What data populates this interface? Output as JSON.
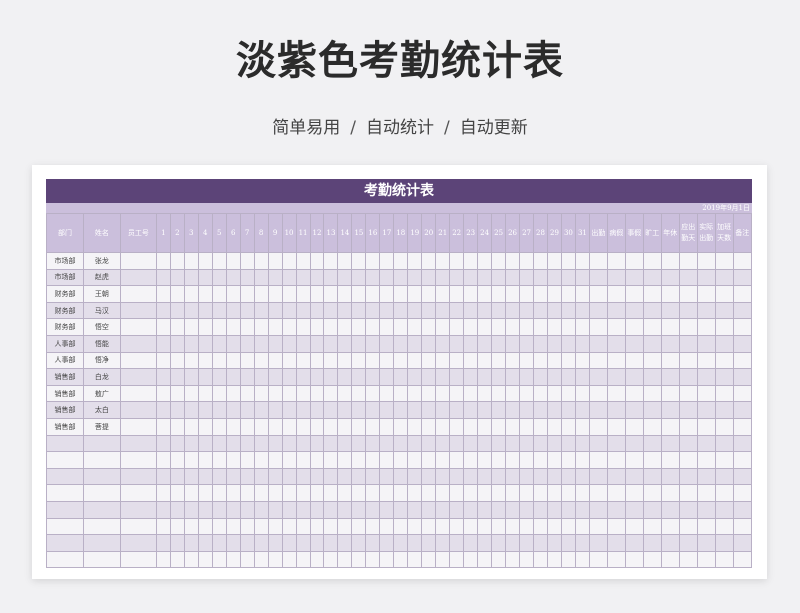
{
  "page": {
    "title": "淡紫色考勤统计表",
    "tags": [
      "简单易用",
      "自动统计",
      "自动更新"
    ],
    "separator": "/"
  },
  "sheet": {
    "banner": "考勤统计表",
    "date": "2019年9月1日",
    "headers": {
      "dept": "部门",
      "name": "姓名",
      "emp_id": "员工号",
      "days": [
        "1",
        "2",
        "3",
        "4",
        "5",
        "6",
        "7",
        "8",
        "9",
        "10",
        "11",
        "12",
        "13",
        "14",
        "15",
        "16",
        "17",
        "18",
        "19",
        "20",
        "21",
        "22",
        "23",
        "24",
        "25",
        "26",
        "27",
        "28",
        "29",
        "30",
        "31"
      ],
      "stats": [
        "出勤",
        "病假",
        "事假",
        "旷工",
        "年休",
        "应出勤天",
        "实际出勤",
        "加班天数",
        "备注"
      ]
    },
    "rows": [
      {
        "dept": "市场部",
        "name": "张龙"
      },
      {
        "dept": "市场部",
        "name": "赵虎"
      },
      {
        "dept": "财务部",
        "name": "王朝"
      },
      {
        "dept": "财务部",
        "name": "马汉"
      },
      {
        "dept": "财务部",
        "name": "悟空"
      },
      {
        "dept": "人事部",
        "name": "悟能"
      },
      {
        "dept": "人事部",
        "name": "悟净"
      },
      {
        "dept": "销售部",
        "name": "白龙"
      },
      {
        "dept": "销售部",
        "name": "敖广"
      },
      {
        "dept": "销售部",
        "name": "太白"
      },
      {
        "dept": "销售部",
        "name": "菩提"
      }
    ],
    "empty_rows": 8
  },
  "colors": {
    "banner": "#5c4478",
    "header": "#cbbfdc",
    "row_light": "#f5f4f7",
    "row_dark": "#e3deea",
    "grid": "#b9b0c6"
  }
}
